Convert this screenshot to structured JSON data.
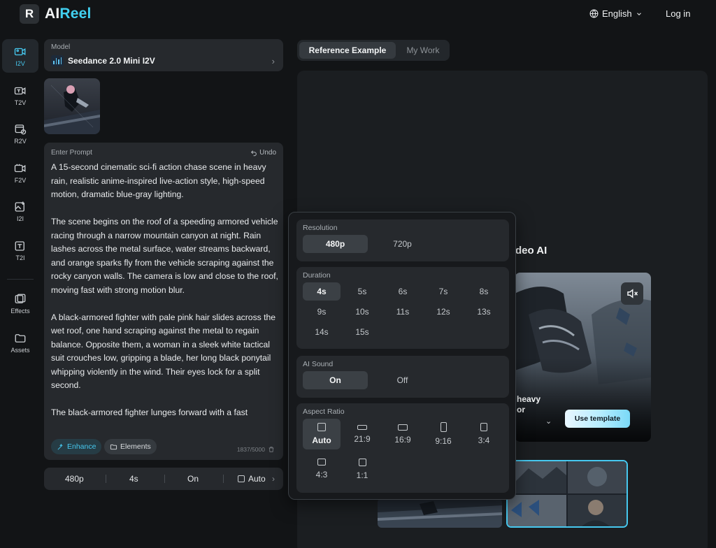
{
  "header": {
    "logo_text": "AIReel",
    "logo_letter": "R",
    "language": "English",
    "login": "Log in"
  },
  "nav": {
    "items": [
      {
        "label": "I2V",
        "icon": "image-to-video-icon"
      },
      {
        "label": "T2V",
        "icon": "text-to-video-icon"
      },
      {
        "label": "R2V",
        "icon": "reference-to-video-icon"
      },
      {
        "label": "F2V",
        "icon": "frame-to-video-icon"
      },
      {
        "label": "I2I",
        "icon": "image-to-image-icon"
      },
      {
        "label": "T2I",
        "icon": "text-to-image-icon"
      },
      {
        "label": "Effects",
        "icon": "effects-icon"
      },
      {
        "label": "Assets",
        "icon": "folder-icon"
      }
    ]
  },
  "model": {
    "label": "Model",
    "name": "Seedance 2.0 Mini I2V"
  },
  "prompt": {
    "label": "Enter Prompt",
    "undo": "Undo",
    "text": "A 15-second cinematic sci-fi action chase scene in heavy rain, realistic anime-inspired live-action style, high-speed motion, dramatic blue-gray lighting.\n\nThe scene begins on the roof of a speeding armored vehicle racing through a narrow mountain canyon at night. Rain lashes across the metal surface, water streams backward, and orange sparks fly from the vehicle scraping against the rocky canyon walls. The camera is low and close to the roof, moving fast with strong motion blur.\n\nA black-armored fighter with pale pink hair slides across the wet roof, one hand scraping against the metal to regain balance. Opposite them, a woman in a sleek white tactical suit crouches low, gripping a blade, her long black ponytail whipping violently in the wind. Their eyes lock for a split second.\n\nThe black-armored fighter lunges forward with a fast",
    "enhance": "Enhance",
    "elements": "Elements",
    "count": "1837/5000"
  },
  "settings_bar": {
    "resolution": "480p",
    "duration": "4s",
    "sound": "On",
    "aspect": "Auto"
  },
  "tabs": {
    "active": "Reference Example",
    "inactive": "My Work"
  },
  "preview": {
    "title_partial": "deo AI",
    "caption_line1": "heavy",
    "caption_line2": "or",
    "use_template": "Use template"
  },
  "popover": {
    "resolution": {
      "title": "Resolution",
      "options": [
        "480p",
        "720p"
      ],
      "selected": "480p"
    },
    "duration": {
      "title": "Duration",
      "options": [
        "4s",
        "5s",
        "6s",
        "7s",
        "8s",
        "9s",
        "10s",
        "11s",
        "12s",
        "13s",
        "14s",
        "15s"
      ],
      "selected": "4s"
    },
    "ai_sound": {
      "title": "AI Sound",
      "options": [
        "On",
        "Off"
      ],
      "selected": "On"
    },
    "aspect_ratio": {
      "title": "Aspect Ratio",
      "options": [
        "Auto",
        "21:9",
        "16:9",
        "9:16",
        "3:4",
        "4:3",
        "1:1"
      ],
      "selected": "Auto"
    }
  },
  "colors": {
    "accent": "#46c8ef",
    "background": "#121416",
    "card": "#26292d"
  }
}
